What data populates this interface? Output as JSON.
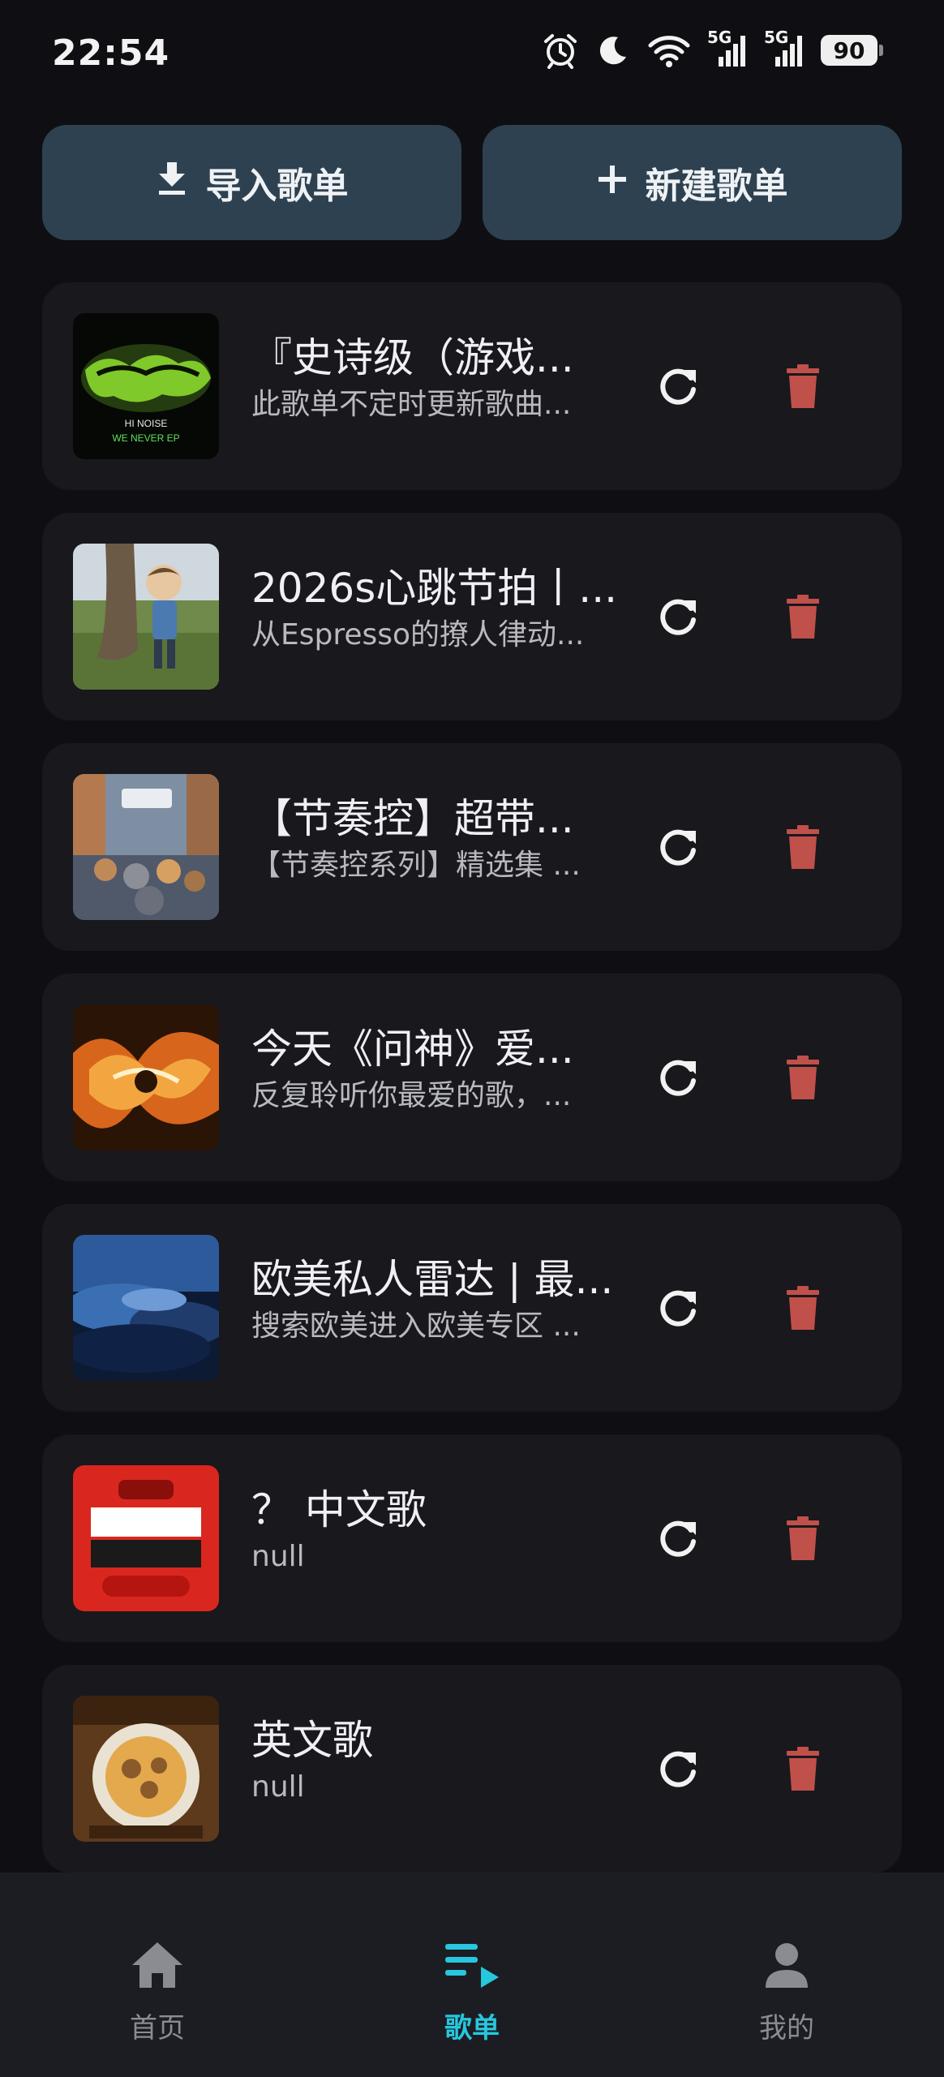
{
  "status_bar": {
    "time": "22:54",
    "signal1_label": "5G",
    "signal2_label": "5G",
    "battery_level": "90",
    "icons": [
      "alarm-icon",
      "moon-icon",
      "wifi-icon",
      "signal-icon",
      "signal-icon",
      "battery-icon"
    ]
  },
  "actions": {
    "import_label": "导入歌单",
    "create_label": "新建歌单",
    "import_icon": "download-icon",
    "create_icon": "plus-icon"
  },
  "playlists": [
    {
      "title": "『史诗级（游戏...",
      "subtitle": "此歌单不定时更新歌曲..."
    },
    {
      "title": "2026s心跳节拍丨...",
      "subtitle": "从Espresso的撩人律动..."
    },
    {
      "title": "【节奏控】超带...",
      "subtitle": "【节奏控系列】精选集 ..."
    },
    {
      "title": "今天《问神》爱...",
      "subtitle": "反复聆听你最爱的歌，..."
    },
    {
      "title": "欧美私人雷达 | 最...",
      "subtitle": "搜索欧美进入欧美专区 ..."
    },
    {
      "title": "？ 中文歌",
      "subtitle": "null"
    },
    {
      "title": "英文歌",
      "subtitle": "null"
    }
  ],
  "colors": {
    "accent": "#27c7dd",
    "delete": "#c0504a",
    "button_bg": "#2e4150",
    "card_bg": "#18181d",
    "page_bg": "#0f0f13"
  },
  "nav": {
    "home": {
      "label": "首页",
      "icon": "home-icon"
    },
    "playlist": {
      "label": "歌单",
      "icon": "playlist-icon",
      "active": true
    },
    "mine": {
      "label": "我的",
      "icon": "person-icon"
    }
  }
}
